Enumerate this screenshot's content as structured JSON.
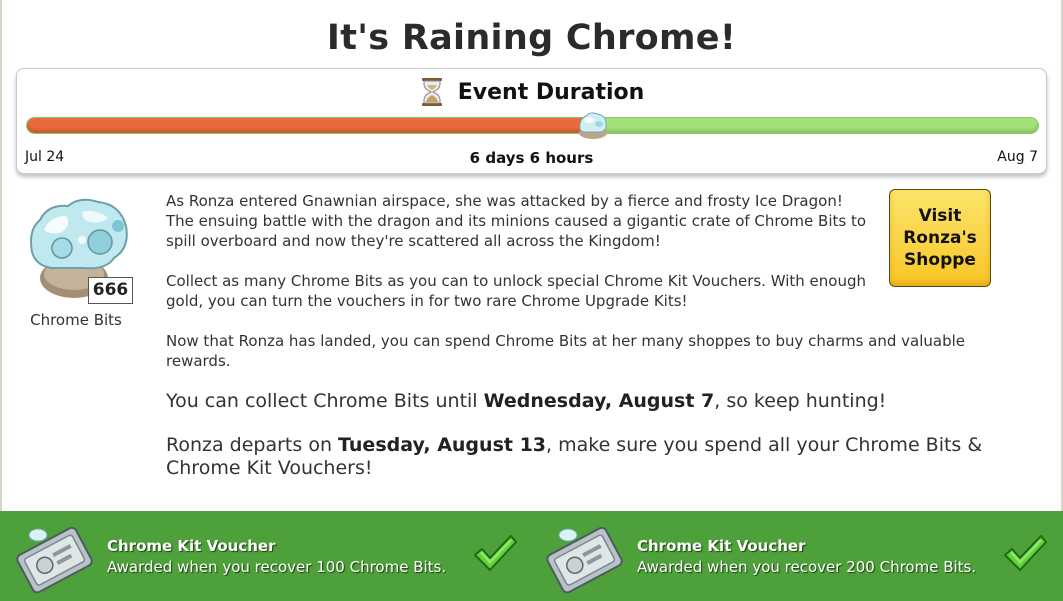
{
  "header": {
    "title": "It's Raining Chrome!"
  },
  "event_duration": {
    "label": "Event Duration",
    "icon": "hourglass-icon",
    "start_label": "Jul 24",
    "end_label": "Aug 7",
    "remaining_label": "6 days 6 hours",
    "progress_fraction": 0.56,
    "elapsed_color": "#e96a3c",
    "remaining_color": "#a3e27a"
  },
  "chrome_bits": {
    "icon": "chrome-bits-icon",
    "count": "666",
    "label": "Chrome Bits"
  },
  "shop_button": {
    "line1": "Visit",
    "line2": "Ronza's",
    "line3": "Shoppe",
    "color": "#f7c626"
  },
  "story": {
    "p1": "As Ronza entered Gnawnian airspace, she was attacked by a fierce and frosty Ice Dragon! The ensuing battle with the dragon and its minions caused a gigantic crate of Chrome Bits to spill overboard and now they're scattered all across the Kingdom!",
    "p2": "Collect as many Chrome Bits as you can to unlock special Chrome Kit Vouchers. With enough gold, you can turn the vouchers in for two rare Chrome Upgrade Kits!",
    "p3": "Now that Ronza has landed, you can spend Chrome Bits at her many shoppes to buy charms and valuable rewards.",
    "collect_pre": "You can collect Chrome Bits until ",
    "collect_date": "Wednesday, August 7",
    "collect_post": ", so keep hunting!",
    "depart_pre": "Ronza departs on ",
    "depart_date": "Tuesday, August 13",
    "depart_post": ", make sure you spend all your Chrome Bits & Chrome Kit Vouchers!"
  },
  "rewards": {
    "background_color": "#4ea13a",
    "items": [
      {
        "title": "Chrome Kit Voucher",
        "description": "Awarded when you recover 100 Chrome Bits.",
        "icon": "voucher-icon",
        "status_icon": "checkmark-icon",
        "completed": true
      },
      {
        "title": "Chrome Kit Voucher",
        "description": "Awarded when you recover 200 Chrome Bits.",
        "icon": "voucher-icon",
        "status_icon": "checkmark-icon",
        "completed": true
      }
    ]
  }
}
